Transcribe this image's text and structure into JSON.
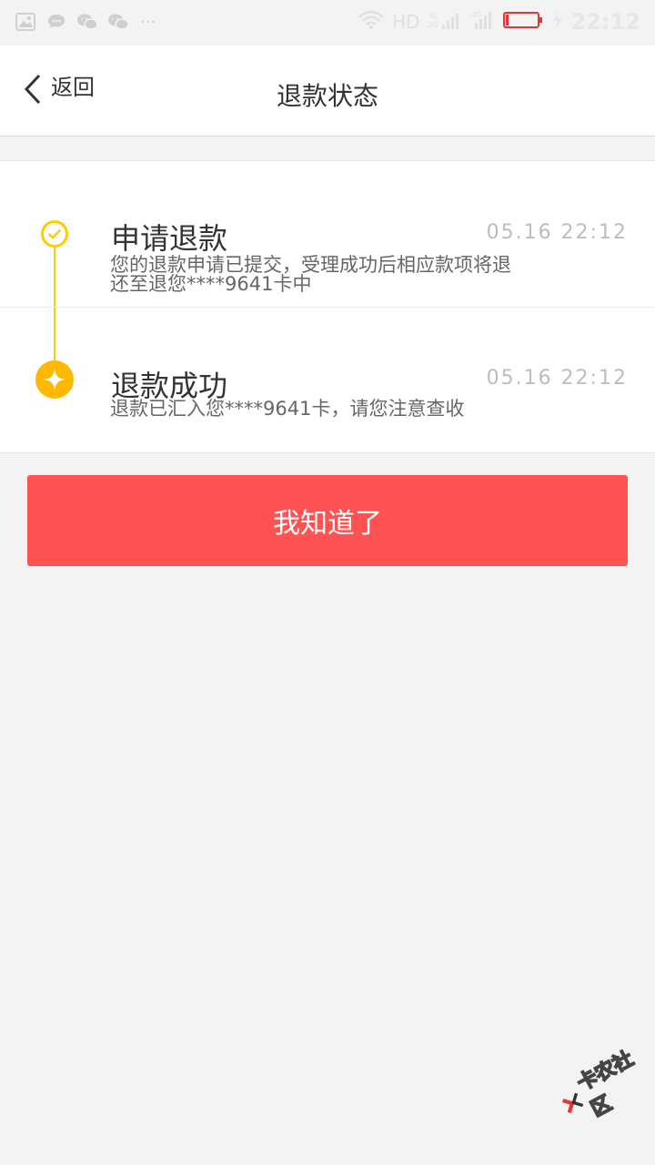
{
  "status_bar": {
    "network": "HD",
    "time": "22:12"
  },
  "header": {
    "back_label": "返回",
    "title": "退款状态"
  },
  "timeline": {
    "accent_color": "#ffcc00",
    "steps": [
      {
        "title": "申请退款",
        "time": "05.16 22:12",
        "description": "您的退款申请已提交，受理成功后相应款项将退还至退您****9641卡中"
      },
      {
        "title": "退款成功",
        "time": "05.16 22:12",
        "description": "退款已汇入您****9641卡，请您注意查收"
      }
    ]
  },
  "confirm_button": {
    "label": "我知道了",
    "color": "#ff5252"
  },
  "watermark": {
    "text": "卡农社区"
  }
}
